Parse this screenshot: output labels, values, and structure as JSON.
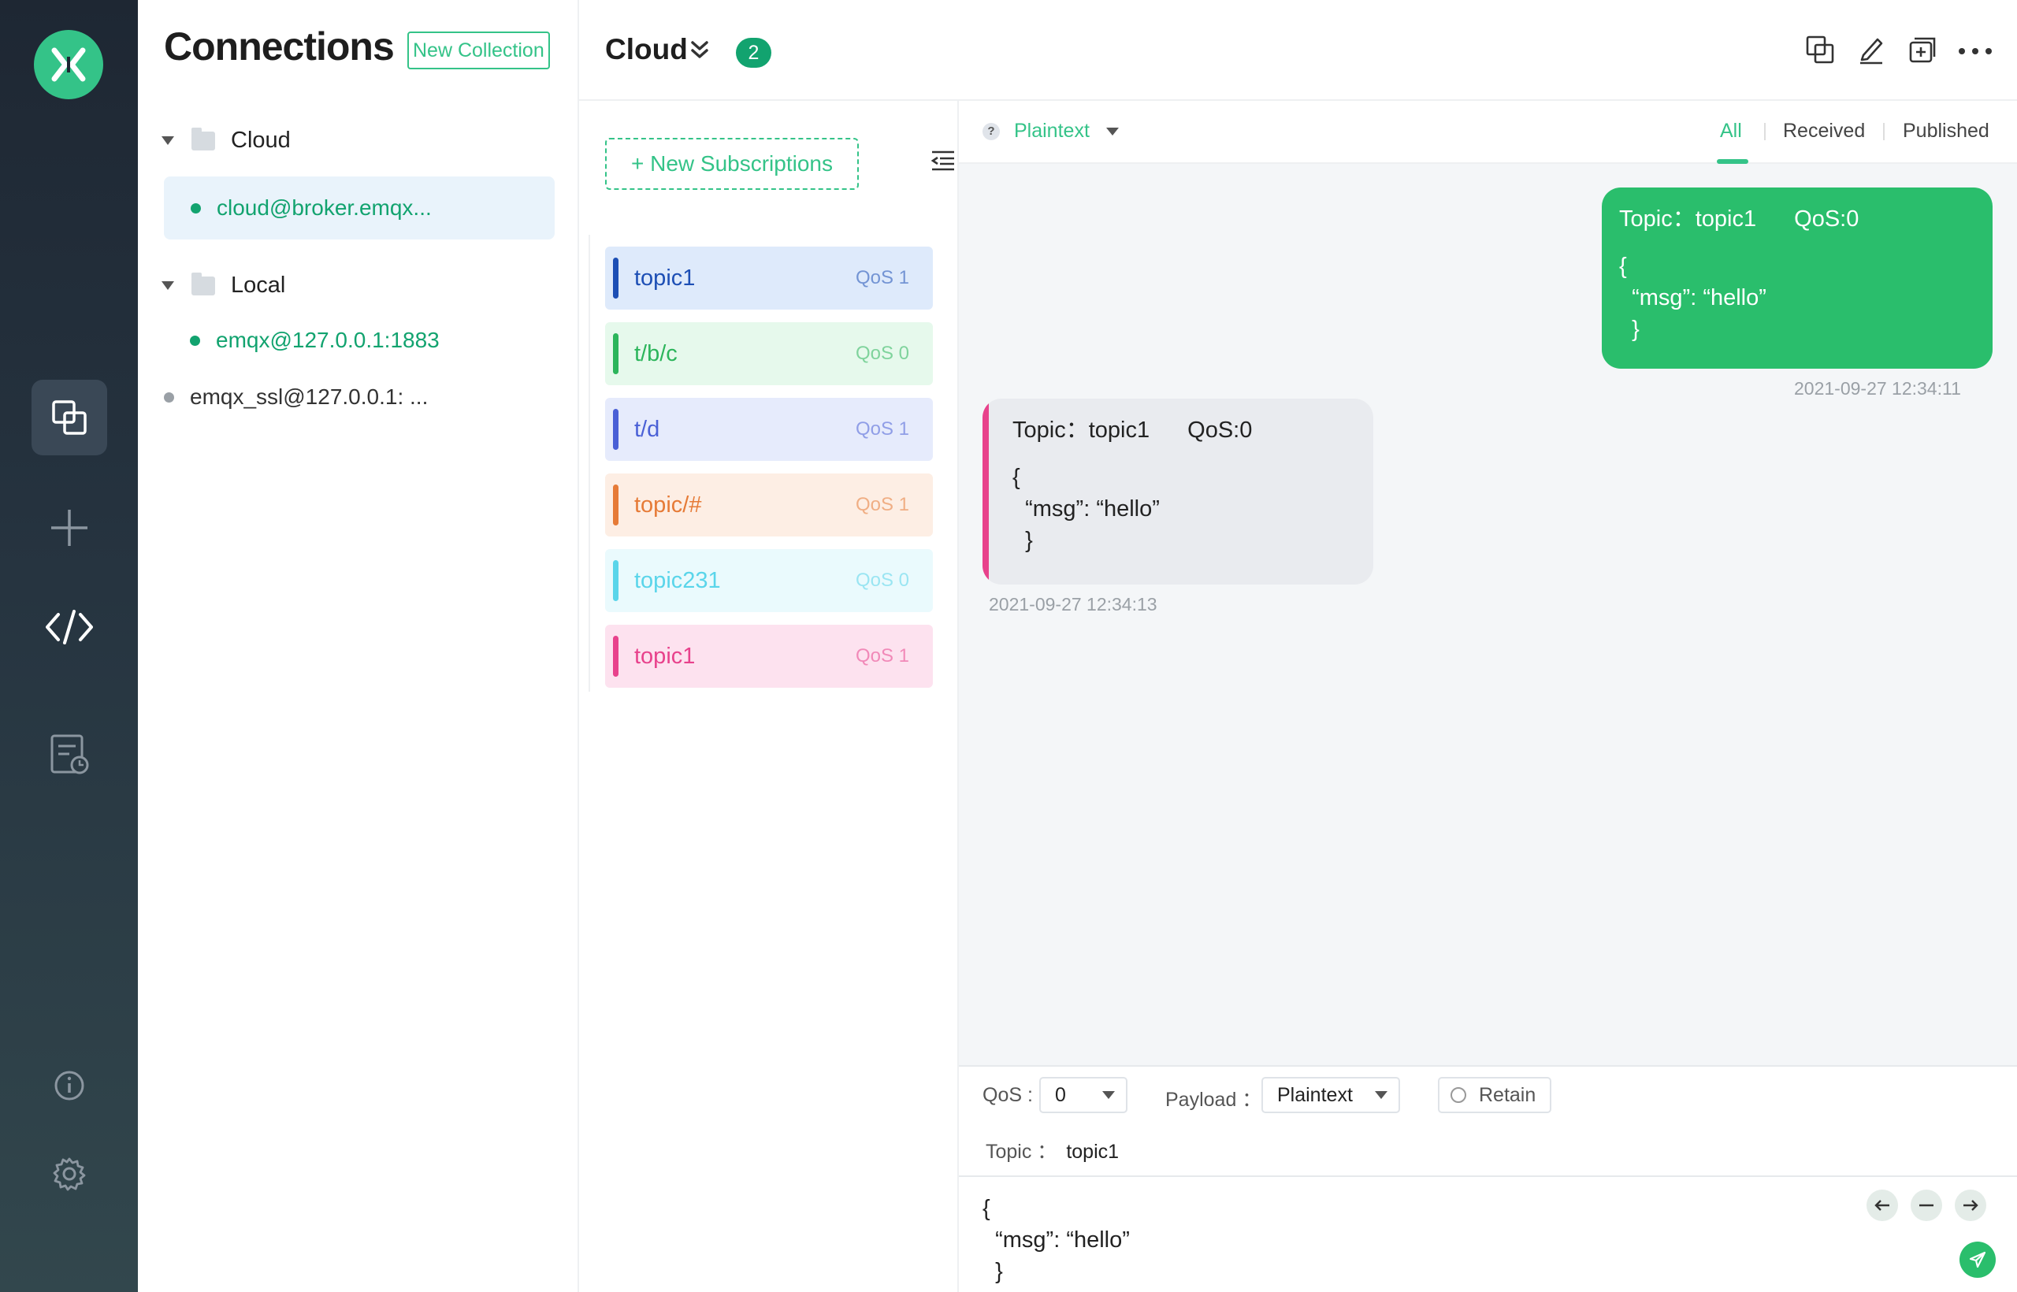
{
  "colors": {
    "accent": "#34c388",
    "rail_bg": "#232e3a",
    "published_bubble": "#2abe6c"
  },
  "sidebar": {
    "logo_icon": "mqttx-logo",
    "items": [
      {
        "icon": "connections-icon",
        "active": true
      },
      {
        "icon": "plus-icon",
        "active": false
      },
      {
        "icon": "code-icon",
        "active": false
      },
      {
        "icon": "log-icon",
        "active": false
      },
      {
        "icon": "info-icon",
        "active": false
      },
      {
        "icon": "gear-icon",
        "active": false
      }
    ]
  },
  "connections": {
    "title": "Connections",
    "new_collection_label": "New Collection",
    "groups": [
      {
        "name": "Cloud",
        "items": [
          {
            "label": "cloud@broker.emqx...",
            "status": "connected",
            "selected": true
          }
        ]
      },
      {
        "name": "Local",
        "items": [
          {
            "label": "emqx@127.0.0.1:1883",
            "status": "connected",
            "selected": false
          }
        ]
      }
    ],
    "ungrouped": [
      {
        "label": "emqx_ssl@127.0.0.1: ...",
        "status": "disconnected"
      }
    ]
  },
  "header": {
    "title": "Cloud",
    "badge": "2",
    "icons": [
      "new-window-icon",
      "edit-icon",
      "new-tab-icon",
      "more-icon"
    ]
  },
  "subscriptions": {
    "new_label": "+ New Subscriptions",
    "items": [
      {
        "topic": "topic1",
        "qos": "QoS 1",
        "color": "#1d4fb5",
        "bg": "#deeafb"
      },
      {
        "topic": "t/b/c",
        "qos": "QoS 0",
        "color": "#2cb55b",
        "bg": "#e6f9ec"
      },
      {
        "topic": "t/d",
        "qos": "QoS 1",
        "color": "#4a60d6",
        "bg": "#e6ebfc"
      },
      {
        "topic": "topic/#",
        "qos": "QoS 1",
        "color": "#e67b37",
        "bg": "#fdeee4"
      },
      {
        "topic": "topic231",
        "qos": "QoS 0",
        "color": "#5ad5ea",
        "bg": "#eafafd"
      },
      {
        "topic": "topic1",
        "qos": "QoS 1",
        "color": "#e8428c",
        "bg": "#fde2ef"
      }
    ]
  },
  "messages": {
    "payload_type": "Plaintext",
    "help": "?",
    "filters": [
      "All",
      "Received",
      "Published"
    ],
    "active_filter": "All",
    "list": [
      {
        "direction": "published",
        "topic": "Topic：topic1",
        "qos": "QoS:0",
        "payload": "{\n  “msg”: “hello”\n  }",
        "time": "2021-09-27   12:34:11"
      },
      {
        "direction": "received",
        "topic": "Topic：topic1",
        "qos": "QoS:0",
        "payload": "{\n  “msg”: “hello”\n  }",
        "time": "2021-09-27   12:34:13"
      }
    ]
  },
  "publish": {
    "qos_label": "QoS :",
    "qos_value": "0",
    "payload_label": "Payload ：",
    "payload_value": "Plaintext",
    "retain_label": "Retain",
    "topic_label": "Topic ：",
    "topic_value": "topic1",
    "payload": "{\n  “msg”: “hello”\n  }"
  }
}
